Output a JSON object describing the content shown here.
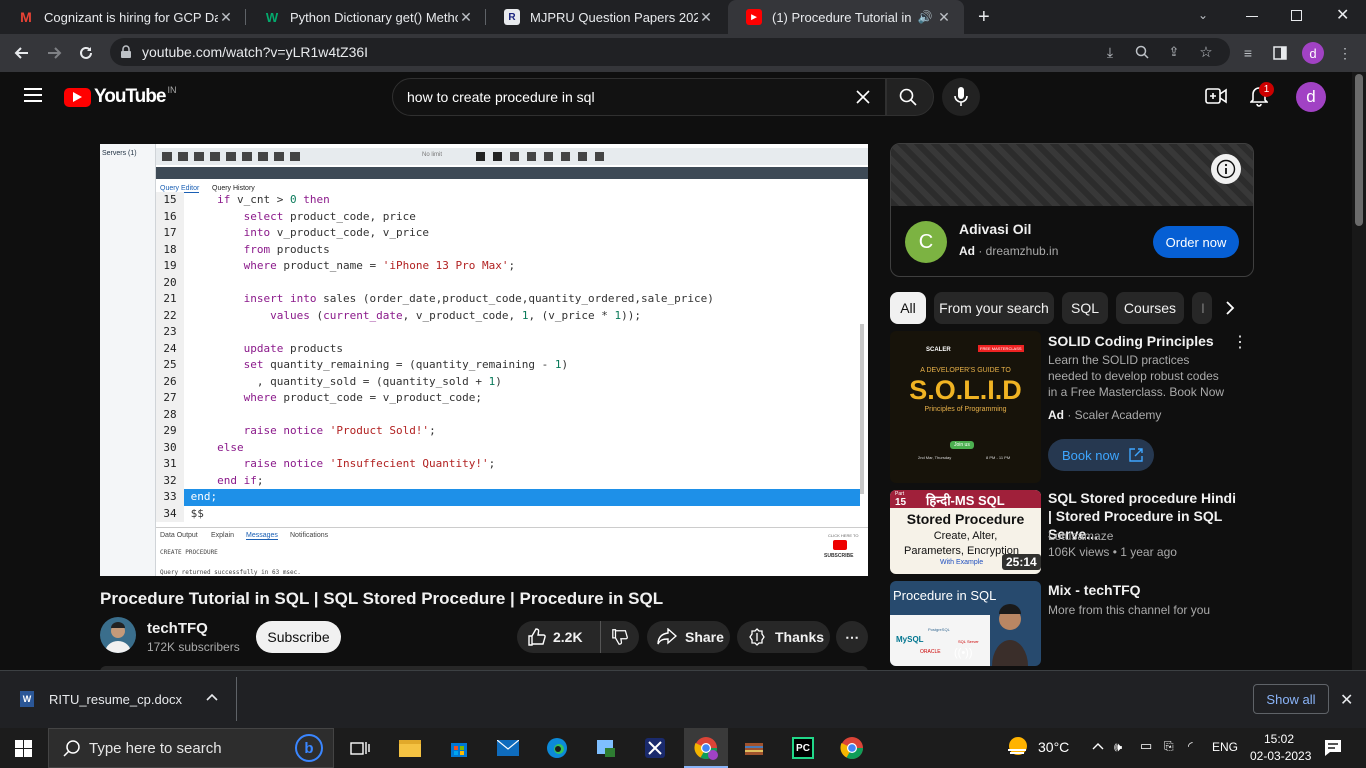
{
  "browser": {
    "tabs": [
      {
        "title": "Cognizant is hiring for GCP Data",
        "favicon": "gmail-icon",
        "close": "✕"
      },
      {
        "title": "Python Dictionary get() Method",
        "favicon": "w3schools-icon",
        "close": "✕"
      },
      {
        "title": "MJPRU Question Papers 2023: Dc",
        "favicon": "site-icon",
        "close": "✕"
      },
      {
        "title": "(1) Procedure Tutorial in SQL",
        "favicon": "youtube-icon",
        "close": "✕",
        "active": true
      }
    ],
    "new_tab": "+",
    "url": "youtube.com/watch?v=yLR1w4tZ36I",
    "profile_initial": "d"
  },
  "youtube": {
    "logo_text": "YouTube",
    "logo_country": "IN",
    "search_query": "how to create procedure in sql",
    "notifications_count": "1",
    "avatar_initial": "d"
  },
  "video": {
    "pgadmin": {
      "servers_label": "Servers (1)",
      "no_limit": "No limit",
      "tabs": [
        "Query Editor",
        "Query History"
      ],
      "output_tabs": [
        "Data Output",
        "Explain",
        "Messages",
        "Notifications"
      ],
      "output_line1": "CREATE PROCEDURE",
      "output_line2": "Query returned successfully in 63 msec.",
      "subscribe_small": "SUBSCRIBE",
      "click_here": "CLICK HERE TO"
    },
    "code_lines": [
      {
        "n": "15",
        "segs": [
          [
            "",
            "    "
          ],
          [
            "kw",
            "if"
          ],
          [
            "",
            " v_cnt > "
          ],
          [
            "num",
            "0"
          ],
          [
            "",
            " "
          ],
          [
            "kw",
            "then"
          ]
        ]
      },
      {
        "n": "16",
        "segs": [
          [
            "",
            "        "
          ],
          [
            "kw",
            "select"
          ],
          [
            "",
            " product_code, price"
          ]
        ]
      },
      {
        "n": "17",
        "segs": [
          [
            "",
            "        "
          ],
          [
            "kw",
            "into"
          ],
          [
            "",
            " v_product_code, v_price"
          ]
        ]
      },
      {
        "n": "18",
        "segs": [
          [
            "",
            "        "
          ],
          [
            "kw",
            "from"
          ],
          [
            "",
            " products"
          ]
        ]
      },
      {
        "n": "19",
        "segs": [
          [
            "",
            "        "
          ],
          [
            "kw",
            "where"
          ],
          [
            "",
            " product_name = "
          ],
          [
            "str",
            "'iPhone 13 Pro Max'"
          ],
          [
            "",
            ";"
          ]
        ]
      },
      {
        "n": "20",
        "segs": [
          [
            "",
            ""
          ]
        ]
      },
      {
        "n": "21",
        "segs": [
          [
            "",
            "        "
          ],
          [
            "kw",
            "insert into"
          ],
          [
            "",
            " sales (order_date,product_code,quantity_ordered,sale_price)"
          ]
        ]
      },
      {
        "n": "22",
        "segs": [
          [
            "",
            "            "
          ],
          [
            "kw",
            "values"
          ],
          [
            "",
            " ("
          ],
          [
            "kw",
            "current_date"
          ],
          [
            "",
            ", v_product_code, "
          ],
          [
            "num",
            "1"
          ],
          [
            "",
            ", (v_price * "
          ],
          [
            "num",
            "1"
          ],
          [
            "",
            "));"
          ]
        ]
      },
      {
        "n": "23",
        "segs": [
          [
            "",
            ""
          ]
        ]
      },
      {
        "n": "24",
        "segs": [
          [
            "",
            "        "
          ],
          [
            "kw",
            "update"
          ],
          [
            "",
            " products"
          ]
        ]
      },
      {
        "n": "25",
        "segs": [
          [
            "",
            "        "
          ],
          [
            "kw",
            "set"
          ],
          [
            "",
            " quantity_remaining = (quantity_remaining - "
          ],
          [
            "num",
            "1"
          ],
          [
            "",
            ")"
          ]
        ]
      },
      {
        "n": "26",
        "segs": [
          [
            "",
            "          , quantity_sold = (quantity_sold + "
          ],
          [
            "num",
            "1"
          ],
          [
            "",
            ")"
          ]
        ]
      },
      {
        "n": "27",
        "segs": [
          [
            "",
            "        "
          ],
          [
            "kw",
            "where"
          ],
          [
            "",
            " product_code = v_product_code;"
          ]
        ]
      },
      {
        "n": "28",
        "segs": [
          [
            "",
            ""
          ]
        ]
      },
      {
        "n": "29",
        "segs": [
          [
            "",
            "        "
          ],
          [
            "kw",
            "raise notice"
          ],
          [
            "",
            " "
          ],
          [
            "str",
            "'Product Sold!'"
          ],
          [
            "",
            ";"
          ]
        ]
      },
      {
        "n": "30",
        "segs": [
          [
            "",
            "    "
          ],
          [
            "kw",
            "else"
          ]
        ]
      },
      {
        "n": "31",
        "segs": [
          [
            "",
            "        "
          ],
          [
            "kw",
            "raise notice"
          ],
          [
            "",
            " "
          ],
          [
            "str",
            "'Insuffecient Quantity!'"
          ],
          [
            "",
            ";"
          ]
        ]
      },
      {
        "n": "32",
        "segs": [
          [
            "",
            "    "
          ],
          [
            "kw",
            "end if"
          ],
          [
            "",
            ";"
          ]
        ]
      },
      {
        "n": "33",
        "segs": [
          [
            "",
            "end;"
          ]
        ],
        "highlight": true
      },
      {
        "n": "34",
        "segs": [
          [
            "",
            "$$"
          ]
        ]
      }
    ],
    "title": "Procedure Tutorial in SQL | SQL Stored Procedure | Procedure in SQL",
    "channel": "techTFQ",
    "subscribers": "172K subscribers",
    "subscribe_label": "Subscribe",
    "likes": "2.2K",
    "share_label": "Share",
    "thanks_label": "Thanks",
    "more_label": "⋯"
  },
  "ad": {
    "advertiser": "Adivasi Oil",
    "avatar_letter": "C",
    "ad_label": "Ad",
    "domain": "dreamzhub.in",
    "cta": "Order now"
  },
  "chips": [
    "All",
    "From your search",
    "SQL",
    "Courses",
    "I"
  ],
  "recommendations": [
    {
      "title": "SOLID Coding Principles",
      "desc": "Learn the SOLID practices needed to develop robust codes in a Free Masterclass. Book Now",
      "ad_label": "Ad",
      "source": "Scaler Academy",
      "cta": "Book now",
      "thumb_brand": "SCALER",
      "thumb_tag": "FREE MASTERCLASS",
      "thumb_subtitle": "A DEVELOPER'S GUIDE TO",
      "thumb_title": "S.O.L.I.D",
      "thumb_caption": "Principles of Programming",
      "thumb_join": "Join us",
      "thumb_date": "2nd Mar, Thursday",
      "thumb_time": "8 PM - 11 PM"
    },
    {
      "title": "SQL Stored procedure Hindi | Stored Procedure in SQL Serve...",
      "channel": "Lotusamaze",
      "views": "106K views",
      "age": "1 year ago",
      "duration": "25:14",
      "thumb_part": "Part",
      "thumb_part_no": "15",
      "thumb_hindi": "हिन्दी-MS SQL",
      "thumb_heading": "Stored Procedure",
      "thumb_line1": "Create, Alter,",
      "thumb_line2": "Parameters, Encryption",
      "thumb_line3": "With Example"
    },
    {
      "title": "Mix - techTFQ",
      "meta": "More from this channel for you",
      "thumb_text": "Procedure in SQL",
      "thumb_mysql": "MySQL",
      "thumb_pg": "PostgreSQL",
      "thumb_sqlserver": "SQL Server",
      "thumb_oracle": "ORACLE"
    }
  ],
  "downloads": {
    "file": "RITU_resume_cp.docx",
    "show_all": "Show all"
  },
  "taskbar": {
    "search_placeholder": "Type here to search",
    "temperature": "30°C",
    "language": "ENG",
    "time": "15:02",
    "date": "02-03-2023"
  },
  "colors": {
    "youtube_red": "#ff0000",
    "link_blue": "#3ea6ff",
    "avatar_purple": "#a142c4",
    "ad_avatar_green": "#7cb342",
    "order_button": "#065fd4",
    "editor_highlight": "#1e90e8"
  }
}
